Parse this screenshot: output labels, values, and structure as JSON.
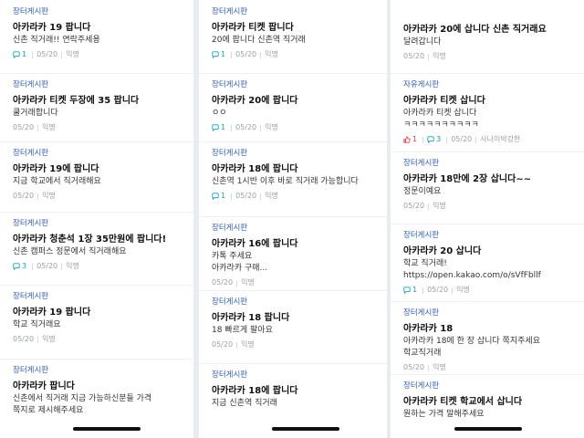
{
  "board_name": "장터게시판",
  "columns": [
    {
      "posts": [
        {
          "board": "장터게시판",
          "title": "아카라카 19 팝니다",
          "body": [
            "신촌 직거래!! 연락주세용"
          ],
          "comments": "1",
          "likes": null,
          "date": "05/20",
          "author": "익명"
        },
        {
          "board": "장터게시판",
          "title": "아카라카 티켓 두장에 35 팝니다",
          "body": [
            "쿨거래합니다"
          ],
          "comments": null,
          "likes": null,
          "date": "05/20",
          "author": "익명"
        },
        {
          "board": "장터게시판",
          "title": "아카라카 19에 팝니다",
          "body": [
            "지금 학교에서 직거래해요"
          ],
          "comments": null,
          "likes": null,
          "date": "05/20",
          "author": "익명"
        },
        {
          "board": "장터게시판",
          "title": "아카라카 청춘석 1장 35만원에 팝니다!",
          "body": [
            "신촌 캠퍼스 정문에서 직거래해요"
          ],
          "comments": "3",
          "likes": null,
          "date": "05/20",
          "author": "익명"
        },
        {
          "board": "장터게시판",
          "title": "아카라카 19 팝니다",
          "body": [
            "학교 직거래요"
          ],
          "comments": null,
          "likes": null,
          "date": "05/20",
          "author": "익명"
        },
        {
          "board": "장터게시판",
          "title": "아카라카 팝니다",
          "body": [
            "신촌에서 직거래 지금 가능하신분들 가격",
            "쪽지로 제시해주세요"
          ],
          "comments": null,
          "likes": null,
          "date": "",
          "author": ""
        }
      ]
    },
    {
      "posts": [
        {
          "board": "장터게시판",
          "title": "아카라카 티켓 팝니다",
          "body": [
            "20에 팝니다 신촌역 직거래"
          ],
          "comments": "1",
          "likes": null,
          "date": "05/20",
          "author": "익명"
        },
        {
          "board": "장터게시판",
          "title": "아카라카 20에 팝니다",
          "body": [
            "ㅇㅇ"
          ],
          "comments": "1",
          "likes": null,
          "date": "05/20",
          "author": "익명"
        },
        {
          "board": "장터게시판",
          "title": "아카라카 18에 팝니다",
          "body": [
            "신촌역 1시반 이후 바로 직거래 가능합니다"
          ],
          "comments": "1",
          "likes": null,
          "date": "05/20",
          "author": "익명"
        },
        {
          "board": "장터게시판",
          "title": "아카라카 16에 팝니다",
          "body": [
            "카톡 주세요",
            "아카라카 구매..."
          ],
          "comments": null,
          "likes": null,
          "date": "05/20",
          "author": "익명"
        },
        {
          "board": "장터게시판",
          "title": "아카라카 18 팝니다",
          "body": [
            "18 빠르게 팔아요"
          ],
          "comments": null,
          "likes": null,
          "date": "05/20",
          "author": "익명"
        },
        {
          "board": "장터게시판",
          "title": "아카라카 18에 팝니다",
          "body": [
            "지금 신촌역 직거래"
          ],
          "comments": null,
          "likes": null,
          "date": "",
          "author": ""
        }
      ]
    },
    {
      "posts": [
        {
          "board": "",
          "title": "아카라카 20에 삽니다 신촌 직거래요",
          "body": [
            "달려갑니다"
          ],
          "comments": null,
          "likes": null,
          "date": "05/20",
          "author": "익명"
        },
        {
          "board": "자유게시판",
          "title": "아카라카 티켓 삽니다",
          "body": [
            "아카라카 티켓 삽니다",
            "ㅋㅋㅋㅋㅋㅋㅋㅋㅋㅋ"
          ],
          "comments": "3",
          "likes": "1",
          "date": "05/20",
          "author": "사나이박강한"
        },
        {
          "board": "장터게시판",
          "title": "아카라카 18만에 2장 삽니다~~",
          "body": [
            "정문이예요"
          ],
          "comments": null,
          "likes": null,
          "date": "05/20",
          "author": "익명"
        },
        {
          "board": "장터게시판",
          "title": "아카라카 20 삽니다",
          "body": [
            "학교 직거래!",
            "https://open.kakao.com/o/sVfFbllf"
          ],
          "comments": "1",
          "likes": null,
          "date": "05/20",
          "author": "익명"
        },
        {
          "board": "장터게시판",
          "title": "아카라카 18",
          "body": [
            "아카라카 18에 한 장 삽니다 쪽지주세요",
            "학교직거래"
          ],
          "comments": null,
          "likes": null,
          "date": "05/20",
          "author": "익명"
        },
        {
          "board": "장터게시판",
          "title": "아카라카 티켓 학교에서 삽니다",
          "body": [
            "원하는 가격 말해주세요"
          ],
          "comments": null,
          "likes": null,
          "date": "",
          "author": ""
        }
      ]
    }
  ],
  "colors": {
    "board": "#2f5fae",
    "comment": "#17a2b8",
    "like": "#e0403a",
    "meta": "#9aa0a6",
    "gutter": "#e9ebee"
  },
  "icons": {
    "comment": "speech-bubble-icon",
    "like": "thumbs-up-icon"
  }
}
